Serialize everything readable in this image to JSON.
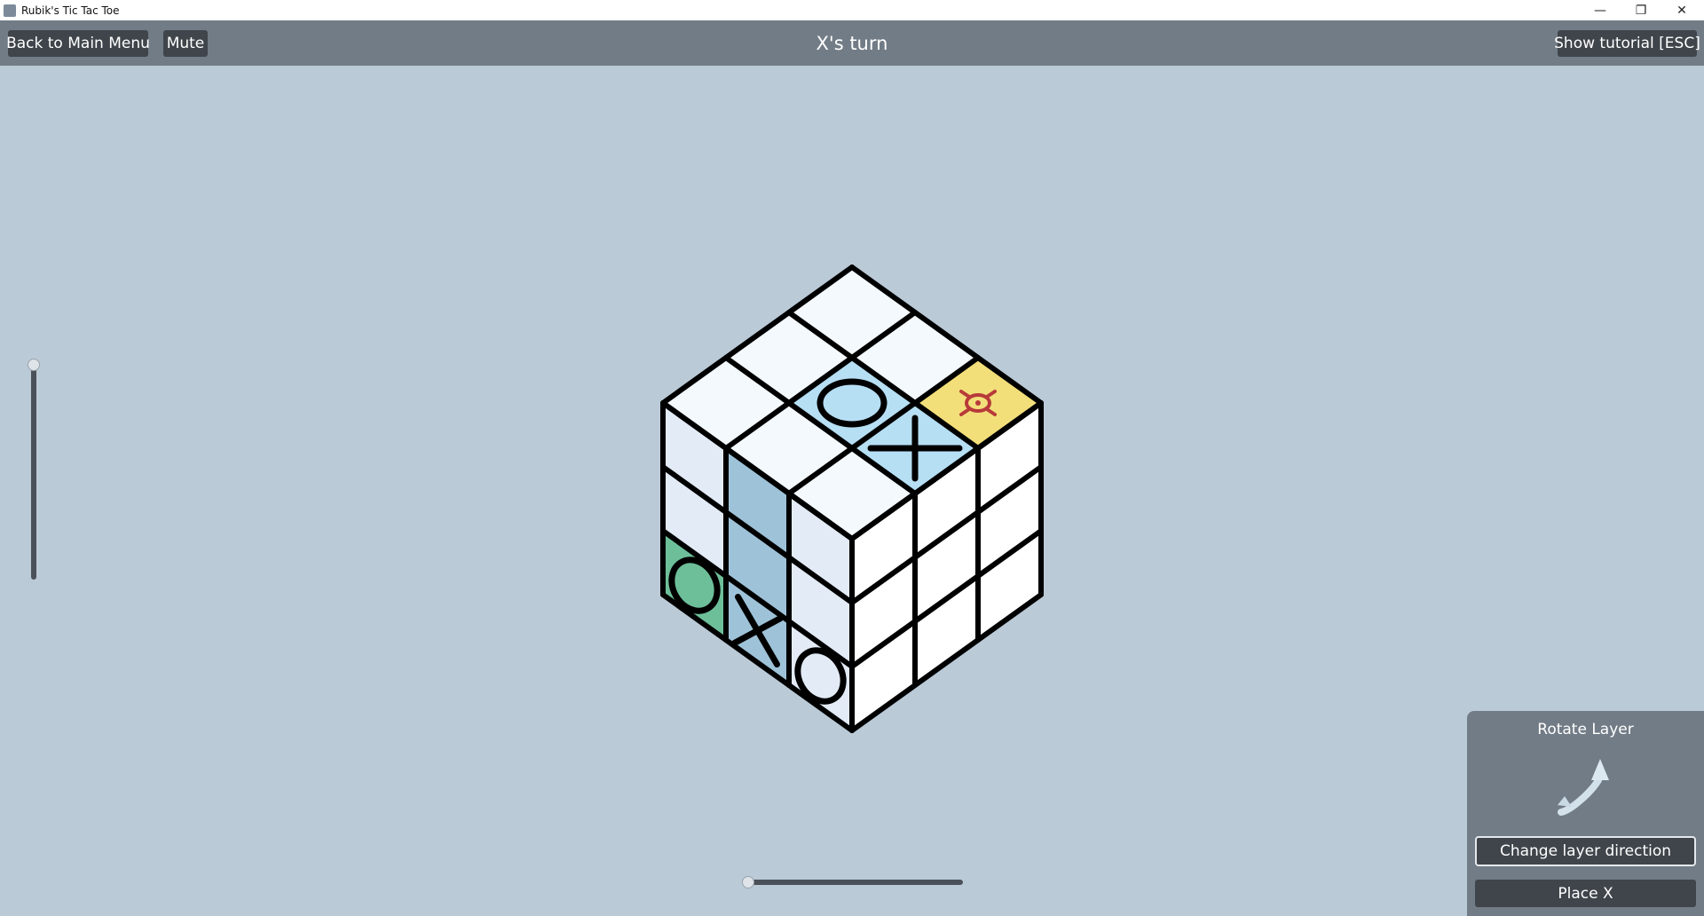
{
  "window": {
    "title": "Rubik's Tic Tac Toe",
    "controls": [
      "minimize",
      "maximize",
      "close"
    ]
  },
  "topbar": {
    "back_label": "Back to Main Menu",
    "mute_label": "Mute",
    "turn_text": "X's turn",
    "tutorial_label": "Show tutorial [ESC]"
  },
  "sliders": {
    "vertical_value": 0,
    "horizontal_value": 0
  },
  "panel": {
    "title": "Rotate Layer",
    "icon": "rotate-layer-arrow-icon",
    "change_direction_label": "Change layer direction",
    "place_label": "Place X"
  },
  "board": {
    "colors": {
      "background": "#bbcad7",
      "white_face": "#f3f9fd",
      "side_face": "#e3ebf6",
      "right_face": "#ffffff",
      "highlight_blue_top": "#b6dff4",
      "highlight_blue_side": "#9ec3d9",
      "yellow": "#f2df7a",
      "green": "#6dbf9a",
      "target_red": "#b83a3a"
    },
    "faces": {
      "top": [
        [
          "empty",
          "empty",
          "target"
        ],
        [
          "empty",
          "O",
          "X"
        ],
        [
          "empty",
          "empty",
          "empty"
        ]
      ],
      "left": [
        [
          "empty",
          "empty",
          "empty"
        ],
        [
          "empty",
          "empty",
          "empty"
        ],
        [
          "O",
          "X",
          "O"
        ]
      ],
      "right": [
        [
          "empty",
          "empty",
          "empty"
        ],
        [
          "empty",
          "empty",
          "empty"
        ],
        [
          "empty",
          "empty",
          "empty"
        ]
      ]
    }
  }
}
